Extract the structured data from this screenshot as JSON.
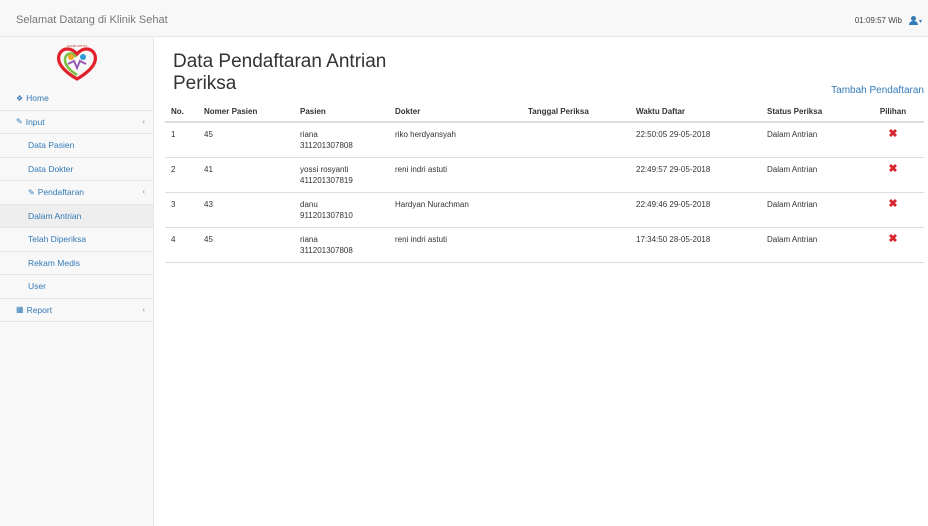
{
  "navbar": {
    "brand": "Selamat Datang di Klinik Sehat",
    "time": "01:09:57 Wib",
    "user_icon": "user-icon",
    "caret": "▾"
  },
  "sidebar": {
    "logo_icon": "clinic-logo-heart",
    "items": [
      {
        "label": "Home",
        "icon": "home-icon"
      },
      {
        "label": "Input",
        "icon": "edit-icon",
        "chevron": "‹"
      },
      {
        "label": "Data Pasien"
      },
      {
        "label": "Data Dokter"
      },
      {
        "label": "Pendaftaran",
        "icon": "edit-icon",
        "chevron": "‹"
      },
      {
        "label": "Dalam Antrian",
        "active": true
      },
      {
        "label": "Telah Diperiksa"
      },
      {
        "label": "Rekam Medis"
      },
      {
        "label": "User"
      },
      {
        "label": "Report",
        "icon": "table-icon",
        "chevron": "‹"
      }
    ]
  },
  "main": {
    "title": "Data Pendaftaran Antrian Periksa",
    "add_link": "Tambah Pendaftaran",
    "table": {
      "headers": [
        "No.",
        "Nomer Pasien",
        "Pasien",
        "Dokter",
        "Tanggal Periksa",
        "Waktu Daftar",
        "Status Periksa",
        "Pilihan"
      ],
      "rows": [
        {
          "no": "1",
          "nomer": "45",
          "pasien": "riana",
          "pasien_id": "311201307808",
          "dokter": "riko herdyansyah",
          "tanggal": "",
          "waktu": "22:50:05 29-05-2018",
          "status": "Dalam Antrian",
          "action": "✖"
        },
        {
          "no": "2",
          "nomer": "41",
          "pasien": "yossi rosyanti",
          "pasien_id": "411201307819",
          "dokter": "reni indri astuti",
          "tanggal": "",
          "waktu": "22:49:57 29-05-2018",
          "status": "Dalam Antrian",
          "action": "✖"
        },
        {
          "no": "3",
          "nomer": "43",
          "pasien": "danu",
          "pasien_id": "911201307810",
          "dokter": "Hardyan Nurachman",
          "tanggal": "",
          "waktu": "22:49:46 29-05-2018",
          "status": "Dalam Antrian",
          "action": "✖"
        },
        {
          "no": "4",
          "nomer": "45",
          "pasien": "riana",
          "pasien_id": "311201307808",
          "dokter": "reni indri astuti",
          "tanggal": "",
          "waktu": "17:34:50 28-05-2018",
          "status": "Dalam Antrian",
          "action": "✖"
        }
      ]
    }
  },
  "colors": {
    "link": "#337ab7",
    "delete": "#d9232d",
    "sidebar_bg": "#f8f8f8",
    "active_bg": "#eeeeee"
  }
}
